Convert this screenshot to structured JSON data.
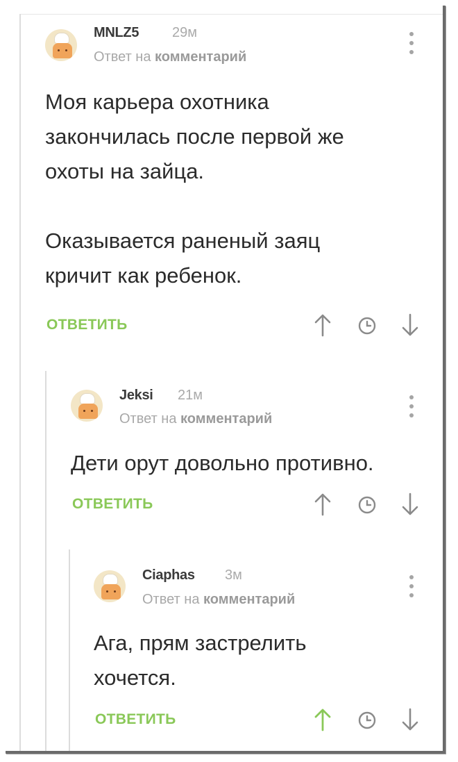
{
  "comments": [
    {
      "username": "MNLZ5",
      "time": "29м",
      "reply_prefix": "Ответ на",
      "reply_link": "комментарий",
      "text": "Моя карьера охотника\nзакончилась после первой же\nохоты на зайца.\n\nОказывается раненый заяц\nкричит как ребенок.",
      "reply_label": "ОТВЕТИТЬ",
      "upvoted": false
    },
    {
      "username": "Jeksi",
      "time": "21м",
      "reply_prefix": "Ответ на",
      "reply_link": "комментарий",
      "text": "Дети орут довольно противно.",
      "reply_label": "ОТВЕТИТЬ",
      "upvoted": false
    },
    {
      "username": "Ciaphas",
      "time": "3м",
      "reply_prefix": "Ответ на",
      "reply_link": "комментарий",
      "text": "Ага, прям застрелить\nхочется.",
      "reply_label": "ОТВЕТИТЬ",
      "upvoted": true
    }
  ],
  "icons": {
    "upvote": "arrow-up-icon",
    "history": "clock-icon",
    "downvote": "arrow-down-icon",
    "menu": "more-vertical-icon",
    "avatar": "chef-avatar"
  },
  "colors": {
    "accent_green": "#8ac858",
    "upvote_active": "#8ac858",
    "icon_gray": "#8a8a8a"
  }
}
